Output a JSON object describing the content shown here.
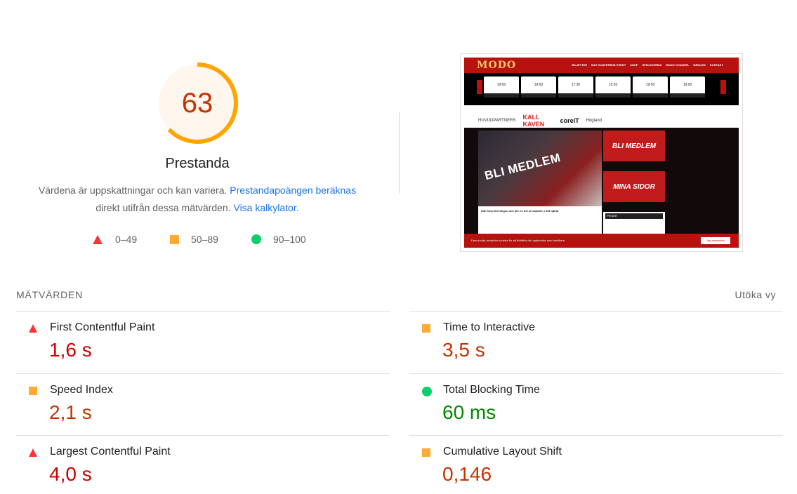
{
  "score": {
    "value": "63",
    "fraction": 0.63,
    "title": "Prestanda",
    "ring_color": "#ffa400",
    "bg_color": "#fff6ed",
    "text_color": "#c33300"
  },
  "description": {
    "text1": "Värdena är uppskattningar och kan variera.",
    "link1": "Prestandapoängen beräknas",
    "text2": "direkt utifrån dessa mätvärden.",
    "link2": "Visa kalkylator."
  },
  "legend": [
    {
      "icon": "triangle",
      "label": "0–49",
      "color": "#ff3333"
    },
    {
      "icon": "square",
      "label": "50–89",
      "color": "#ffaa33"
    },
    {
      "icon": "circle",
      "label": "90–100",
      "color": "#0cce6b"
    }
  ],
  "screenshot": {
    "logo": "MODO",
    "nav": [
      "BILJETTER",
      "MAT KONFERENS EVENT",
      "SHOP",
      "SPELSCHEMA",
      "MODO CHANNEL",
      "MEDLEM",
      "KONTAKT"
    ],
    "games": [
      "19:00",
      "19:00",
      "17:30",
      "15:30",
      "19:00",
      "19:00"
    ],
    "game_more": "MORE",
    "partners_label": "HUVUDPARTNERS",
    "partners": [
      "KALL KAVEN",
      "coreIT",
      "Högland"
    ],
    "hero_text": "BLI MEDLEM",
    "card1": "BLI MEDLEM",
    "card2": "MINA SIDOR",
    "text_heading": "Dibl hela föreningen och blir en del av klubben i ditt hjärta",
    "price_heading": "PRISER",
    "cookie_text": "Denna sida använder cookies för att förbättra din upplevelse som besökare.",
    "cookie_button": "Jag samtycker"
  },
  "metrics_section": {
    "title": "MÄTVÄRDEN",
    "expand": "Utöka vy"
  },
  "metrics_left": [
    {
      "icon": "triangle",
      "name": "First Contentful Paint",
      "value": "1,6 s",
      "status": "fail"
    },
    {
      "icon": "square",
      "name": "Speed Index",
      "value": "2,1 s",
      "status": "avg"
    },
    {
      "icon": "triangle",
      "name": "Largest Contentful Paint",
      "value": "4,0 s",
      "status": "fail"
    }
  ],
  "metrics_right": [
    {
      "icon": "square",
      "name": "Time to Interactive",
      "value": "3,5 s",
      "status": "avg"
    },
    {
      "icon": "circle",
      "name": "Total Blocking Time",
      "value": "60 ms",
      "status": "pass"
    },
    {
      "icon": "square",
      "name": "Cumulative Layout Shift",
      "value": "0,146",
      "status": "avg"
    }
  ]
}
